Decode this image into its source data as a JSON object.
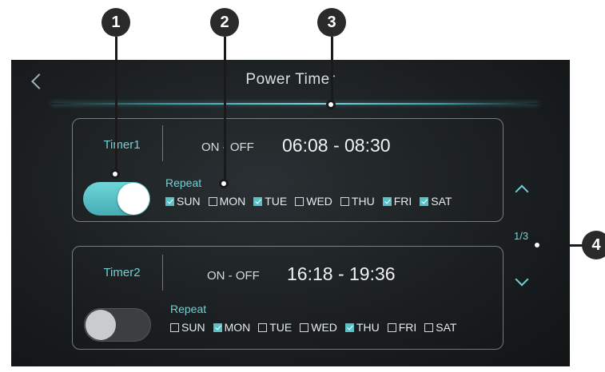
{
  "screen": {
    "back_icon": "chevron-left-icon",
    "title": "Power Timer",
    "accent_color": "#57c3c9"
  },
  "timers": [
    {
      "name": "Timer1",
      "onoff_label": "ON - OFF",
      "time_range": "06:08 - 08:30",
      "enabled": true,
      "repeat_label": "Repeat",
      "days": [
        {
          "label": "SUN",
          "checked": true
        },
        {
          "label": "MON",
          "checked": false
        },
        {
          "label": "TUE",
          "checked": true
        },
        {
          "label": "WED",
          "checked": false
        },
        {
          "label": "THU",
          "checked": false
        },
        {
          "label": "FRI",
          "checked": true
        },
        {
          "label": "SAT",
          "checked": true
        }
      ]
    },
    {
      "name": "Timer2",
      "onoff_label": "ON - OFF",
      "time_range": "16:18 - 19:36",
      "enabled": false,
      "repeat_label": "Repeat",
      "days": [
        {
          "label": "SUN",
          "checked": false
        },
        {
          "label": "MON",
          "checked": true
        },
        {
          "label": "TUE",
          "checked": false
        },
        {
          "label": "WED",
          "checked": false
        },
        {
          "label": "THU",
          "checked": true
        },
        {
          "label": "FRI",
          "checked": false
        },
        {
          "label": "SAT",
          "checked": false
        }
      ]
    }
  ],
  "pager": {
    "up_icon": "chevron-up-icon",
    "text": "1/3",
    "down_icon": "chevron-down-icon"
  },
  "callouts": [
    "1",
    "2",
    "3",
    "4"
  ]
}
